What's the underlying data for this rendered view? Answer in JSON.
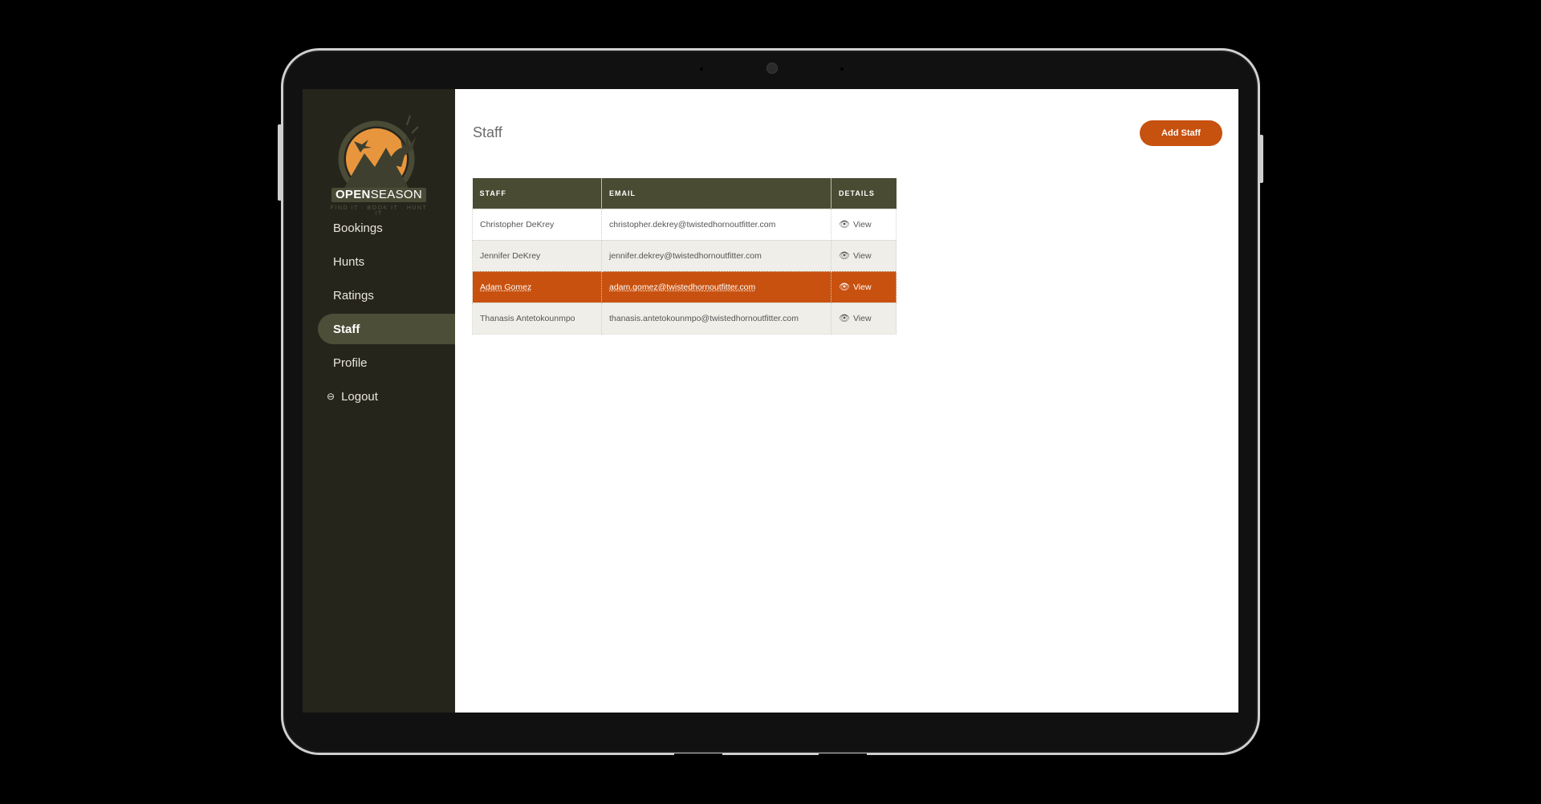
{
  "brand": {
    "name_bold": "OPEN",
    "name_rest": "SEASON",
    "tagline": "FIND IT · BOOK IT · HUNT IT"
  },
  "sidebar": {
    "items": [
      {
        "label": "Bookings",
        "active": false
      },
      {
        "label": "Hunts",
        "active": false
      },
      {
        "label": "Ratings",
        "active": false
      },
      {
        "label": "Staff",
        "active": true
      },
      {
        "label": "Profile",
        "active": false
      },
      {
        "label": "Logout",
        "active": false,
        "icon": "logout-icon"
      }
    ]
  },
  "page": {
    "title": "Staff",
    "add_button": "Add Staff"
  },
  "table": {
    "headers": [
      "STAFF",
      "EMAIL",
      "DETAILS"
    ],
    "rows": [
      {
        "name": "Christopher DeKrey",
        "email": "christopher.dekrey@twistedhornoutfitter.com",
        "details": "View"
      },
      {
        "name": "Jennifer DeKrey",
        "email": "jennifer.dekrey@twistedhornoutfitter.com",
        "details": "View"
      },
      {
        "name": "Adam Gomez",
        "email": "adam.gomez@twistedhornoutfitter.com",
        "details": "View",
        "highlighted": true
      },
      {
        "name": "Thanasis Antetokounmpo",
        "email": "thanasis.antetokounmpo@twistedhornoutfitter.com",
        "details": "View"
      }
    ]
  },
  "colors": {
    "accent": "#c8510f",
    "sidebar": "#26251c",
    "header": "#4a4b33",
    "active_nav": "#4d4e37"
  }
}
